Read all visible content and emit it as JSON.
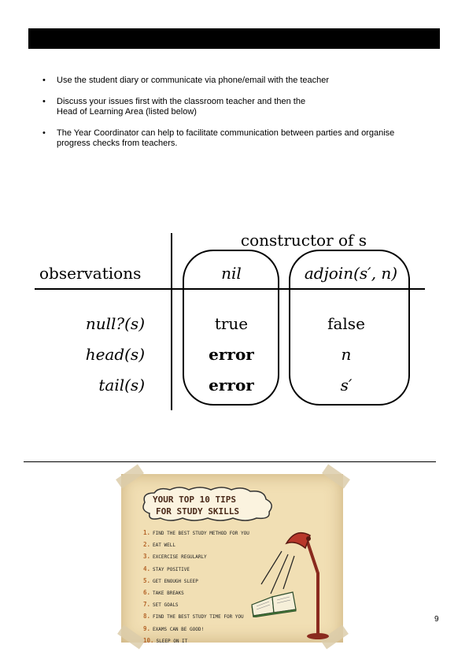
{
  "bullets": [
    {
      "lines": [
        "Use the student diary or communicate via phone/email with the teacher"
      ]
    },
    {
      "lines": [
        "Discuss your issues first with the classroom teacher and then the",
        "Head of Learning Area (listed below)"
      ]
    },
    {
      "lines": [
        "The Year Coordinator can help to facilitate communication between parties and organise",
        "progress checks from teachers."
      ]
    }
  ],
  "table": {
    "header": "constructor of s",
    "observations_label": "observations",
    "constructors": [
      "nil",
      "adjoin(s′, n)"
    ],
    "rows": [
      {
        "obs": "null?(s)",
        "nil": "true",
        "adjoin": "false"
      },
      {
        "obs": "head(s)",
        "nil": "error",
        "adjoin": "n"
      },
      {
        "obs": "tail(s)",
        "nil": "error",
        "adjoin": "s′"
      }
    ]
  },
  "poster": {
    "title_line1": "YOUR TOP 10 TIPS",
    "title_line2": "FOR STUDY SKILLS",
    "tips": [
      {
        "num": "1.",
        "text": "FIND THE BEST STUDY METHOD FOR YOU"
      },
      {
        "num": "2.",
        "text": "EAT WELL"
      },
      {
        "num": "3.",
        "text": "EXCERCISE REGULARLY"
      },
      {
        "num": "4.",
        "text": "STAY POSITIVE"
      },
      {
        "num": "5.",
        "text": "GET ENOUGH SLEEP"
      },
      {
        "num": "6.",
        "text": "TAKE BREAKS"
      },
      {
        "num": "7.",
        "text": "SET GOALS"
      },
      {
        "num": "8.",
        "text": "FIND THE BEST STUDY TIME FOR YOU"
      },
      {
        "num": "9.",
        "text": "EXAMS CAN BE GOOD!"
      },
      {
        "num": "10.",
        "text": "SLEEP ON IT"
      }
    ]
  },
  "page_number": "9"
}
